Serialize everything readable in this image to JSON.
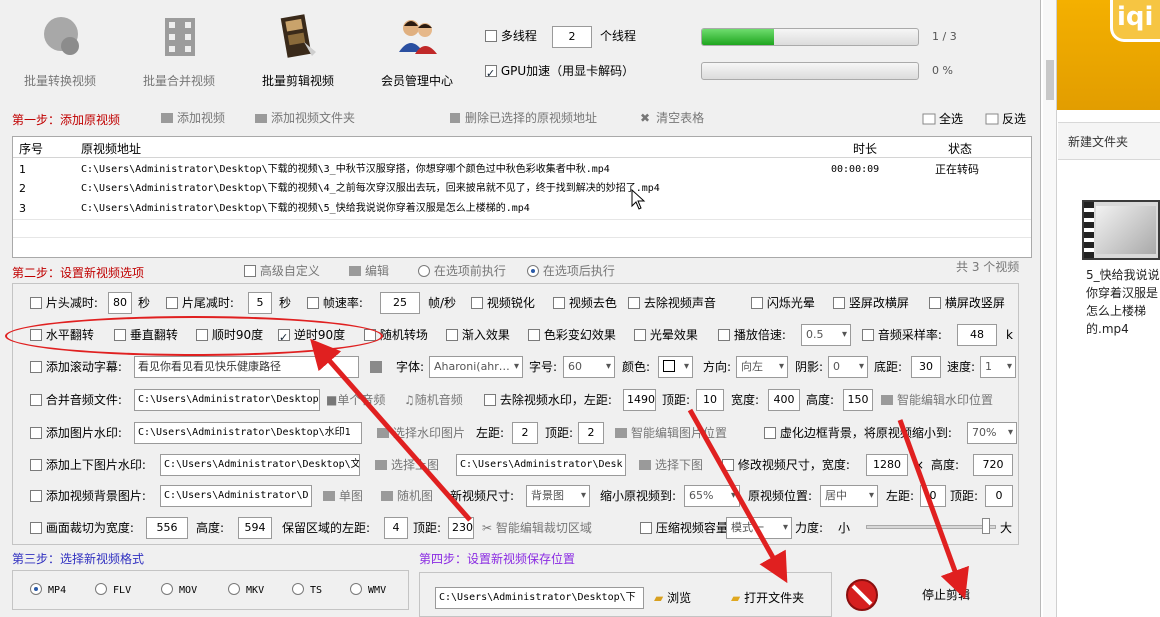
{
  "toolbar": {
    "batch_convert": "批量转换视频",
    "batch_merge": "批量合并视频",
    "batch_cut": "批量剪辑视频",
    "member": "会员管理中心"
  },
  "threads": {
    "multi_label": "多线程",
    "count": "2",
    "unit": "个线程",
    "gpu_label": "GPU加速（用显卡解码）",
    "progress1_text": "1 / 3",
    "progress1_value": 0.333,
    "progress2_text": "0 %",
    "progress2_value": 0
  },
  "step1": {
    "title": "第一步：添加原视频",
    "add_video": "添加视频",
    "add_folder": "添加视频文件夹",
    "delete_selected": "删除已选择的原视频地址",
    "clear_table": "清空表格",
    "select_all": "全选",
    "invert": "反选"
  },
  "table": {
    "headers": [
      "序号",
      "原视频地址",
      "时长",
      "状态"
    ],
    "rows": [
      {
        "index": "1",
        "path": "C:\\Users\\Administrator\\Desktop\\下载的视频\\3_中秋节汉服穿搭，你想穿哪个颜色过中秋色彩收集者中秋.mp4",
        "duration": "00:00:09",
        "status": "正在转码"
      },
      {
        "index": "2",
        "path": "C:\\Users\\Administrator\\Desktop\\下载的视频\\4_之前每次穿汉服出去玩，回来披帛就不见了，终于找到解决的妙招了.mp4",
        "duration": "",
        "status": ""
      },
      {
        "index": "3",
        "path": "C:\\Users\\Administrator\\Desktop\\下载的视频\\5_快给我说说你穿着汉服是怎么上楼梯的.mp4",
        "duration": "",
        "status": ""
      }
    ]
  },
  "step2": {
    "title": "第二步：设置新视频选项",
    "advanced": "高级自定义",
    "edit": "编辑",
    "before": "在选项前执行",
    "after": "在选项后执行",
    "count": "共 3 个视频"
  },
  "row1": {
    "head_cut": "片头减时:",
    "head_val": "80",
    "sec1": "秒",
    "tail_cut": "片尾减时:",
    "tail_val": "5",
    "sec2": "秒",
    "fps": "帧速率:",
    "fps_val": "25",
    "fps_unit": "帧/秒",
    "sharpen": "视频锐化",
    "decolor": "视频去色",
    "remove_audio": "去除视频声音",
    "flash": "闪烁光晕",
    "v2h": "竖屏改横屏",
    "h2v": "横屏改竖屏"
  },
  "row2": {
    "hflip": "水平翻转",
    "vflip": "垂直翻转",
    "cw90": "顺时90度",
    "ccw90": "逆时90度",
    "random_trans": "随机转场",
    "fade": "渐入效果",
    "color_fx": "色彩变幻效果",
    "halo": "光晕效果",
    "speed": "播放倍速:",
    "speed_val": "0.5",
    "sample": "音频采样率:",
    "sample_val": "48",
    "k": "k"
  },
  "row3": {
    "scroll_sub": "添加滚动字幕:",
    "sub_text": "看见你看见看见快乐健康路径",
    "font": "字体:",
    "font_val": "Aharoni(ahr…",
    "size": "字号:",
    "size_val": "60",
    "color": "颜色:",
    "dir": "方向:",
    "dir_val": "向左",
    "shadow": "阴影:",
    "shadow_val": "0",
    "bottom": "底距:",
    "bottom_val": "30",
    "speed": "速度:",
    "speed_val": "1"
  },
  "row4": {
    "merge_audio": "合并音频文件:",
    "audio_path": "C:\\Users\\Administrator\\Desktop",
    "single_audio": "单个音频",
    "random_audio": "随机音频",
    "remove_wm": "去除视频水印，左距:",
    "wm_left": "1490",
    "top": "顶距:",
    "wm_top": "10",
    "width": "宽度:",
    "wm_w": "400",
    "height": "高度:",
    "wm_h": "150",
    "smart_wm": "智能编辑水印位置"
  },
  "row5": {
    "img_wm": "添加图片水印:",
    "img_path": "C:\\Users\\Administrator\\Desktop\\水印1",
    "choose_img": "选择水印图片",
    "left": "左距:",
    "left_val": "2",
    "top": "顶距:",
    "top_val": "2",
    "smart_img": "智能编辑图片位置",
    "blur_bg": "虚化边框背景，将原视频缩小到:",
    "blur_val": "70%"
  },
  "row6": {
    "topbottom": "添加上下图片水印:",
    "top_path": "C:\\Users\\Administrator\\Desktop\\文",
    "choose_top": "选择上图",
    "bottom_path": "C:\\Users\\Administrator\\Desk",
    "choose_bottom": "选择下图",
    "resize": "修改视频尺寸，宽度:",
    "w_val": "1280",
    "x": "×",
    "h_label": "高度:",
    "h_val": "720"
  },
  "row7": {
    "bg_img": "添加视频背景图片:",
    "bg_path": "C:\\Users\\Administrator\\D",
    "single": "单图",
    "random": "随机图",
    "new_size": "新视频尺寸:",
    "size_val": "背景图",
    "shrink": "缩小原视频到:",
    "shrink_val": "65%",
    "pos": "原视频位置:",
    "pos_val": "居中",
    "left": "左距:",
    "left_val": "0",
    "top": "顶距:",
    "top_val": "0"
  },
  "row8": {
    "crop": "画面裁切为宽度:",
    "crop_w": "556",
    "height": "高度:",
    "crop_h": "594",
    "keep_left": "保留区域的左距:",
    "keep_left_val": "4",
    "top": "顶距:",
    "top_val": "230",
    "smart_crop": "智能编辑裁切区域",
    "compress": "压缩视频容量",
    "mode": "模式一",
    "strength": "力度:",
    "small": "小",
    "big": "大",
    "strength_value": 0.95
  },
  "step3": {
    "title": "第三步：选择新视频格式",
    "formats": [
      "MP4",
      "FLV",
      "MOV",
      "MKV",
      "TS",
      "WMV"
    ],
    "selected": "MP4"
  },
  "step4": {
    "title": "第四步：设置新视频保存位置",
    "path": "C:\\Users\\Administrator\\Desktop\\下",
    "browse": "浏览",
    "open_folder": "打开文件夹",
    "stop": "停止剪辑"
  },
  "explorer": {
    "new_folder": "新建文件夹",
    "file_label": "5_快给我说说你穿着汉服是怎么上楼梯的.mp4",
    "logo": "iqi"
  },
  "colors": {
    "step_red": "#c00000",
    "step_purple": "#8a2be2",
    "step_blue": "#3030c0",
    "annotation_red": "#e02020",
    "progress_green": "#1ea51e"
  }
}
